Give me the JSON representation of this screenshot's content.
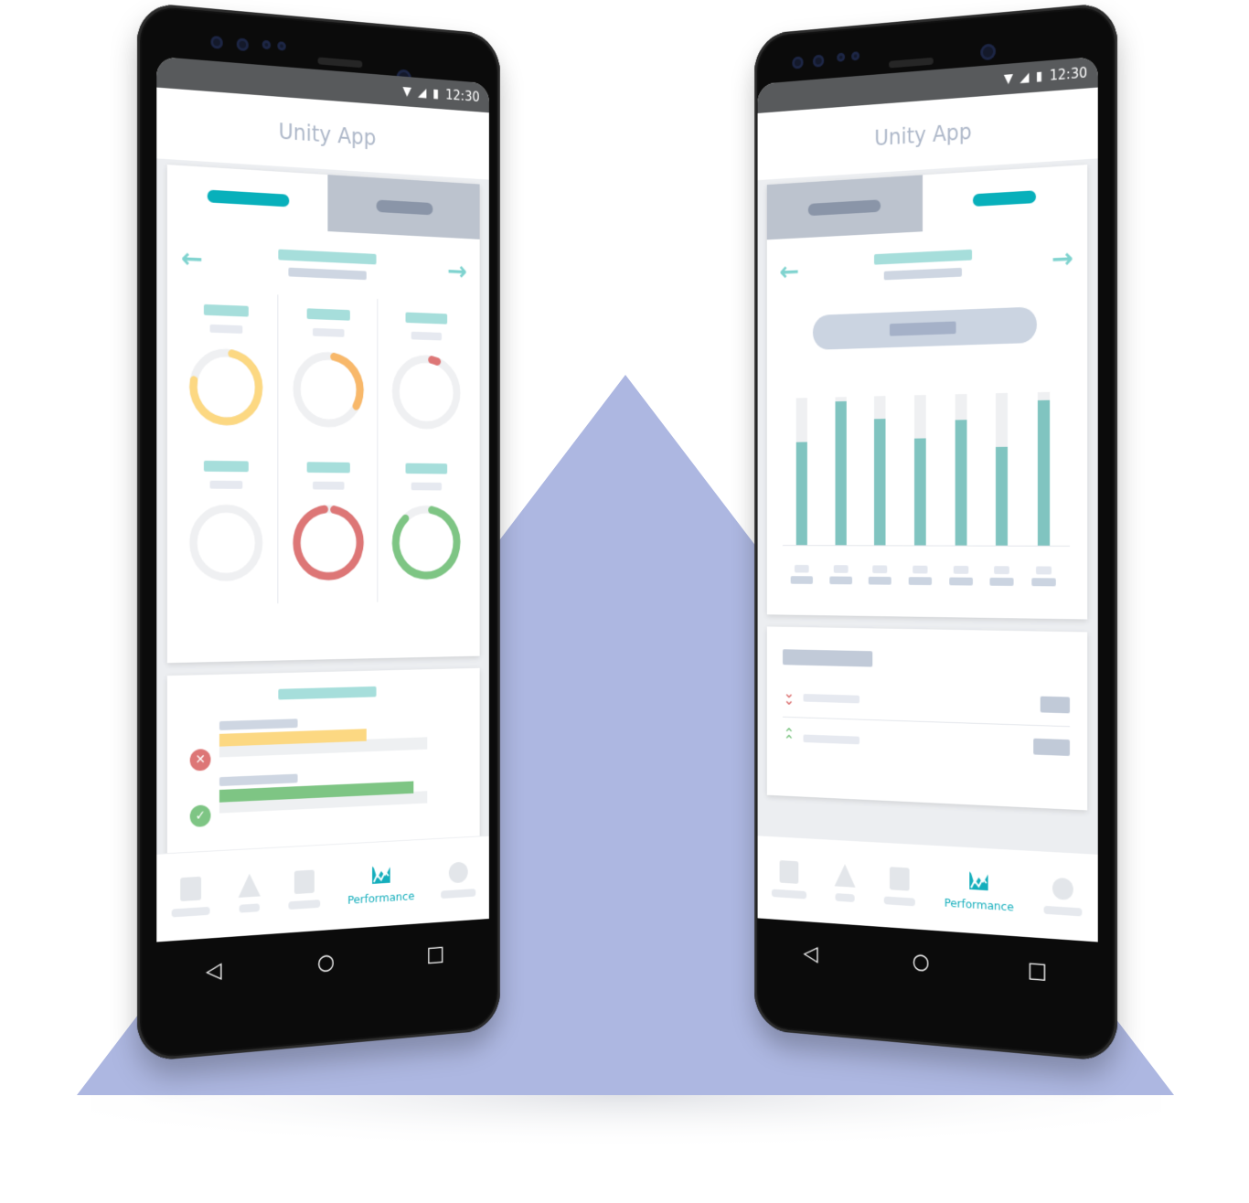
{
  "colors": {
    "backdrop_triangle": "#adb7e1",
    "accent_teal": "#08b0bb",
    "placeholder_teal": "#a6dedb",
    "bar_teal": "#80c4c0",
    "gauge_yellow": "#fcd882",
    "gauge_orange": "#f8b86a",
    "gauge_red": "#dd7676",
    "gauge_green": "#7ec584",
    "gauge_track": "#eff0f2",
    "status_bar": "#585a5c"
  },
  "status_bar": {
    "time": "12:30",
    "icons": [
      "wifi-icon",
      "signal-icon",
      "battery-icon"
    ]
  },
  "phones": [
    {
      "id": "left",
      "app_title": "Unity App",
      "active_tab_index": 0,
      "nav_prev_icon": "arrow-left-icon",
      "nav_next_icon": "arrow-right-icon",
      "gauges": [
        {
          "color": "gauge_yellow",
          "fraction": 0.75
        },
        {
          "color": "gauge_orange",
          "fraction": 0.3
        },
        {
          "color": "gauge_red",
          "fraction": 0.03
        },
        {
          "color": "gauge_track",
          "fraction": 0.0
        },
        {
          "color": "gauge_red",
          "fraction": 0.95
        },
        {
          "color": "gauge_green",
          "fraction": 0.85
        }
      ],
      "metrics": [
        {
          "status": "fail",
          "status_icon": "x-circle-icon",
          "color": "#fcd882",
          "fraction": 0.7
        },
        {
          "status": "pass",
          "status_icon": "check-circle-icon",
          "color": "#7ec584",
          "fraction": 0.93
        }
      ]
    },
    {
      "id": "right",
      "app_title": "Unity App",
      "active_tab_index": 1,
      "nav_prev_icon": "arrow-left-icon",
      "nav_next_icon": "arrow-right-icon",
      "trends": [
        {
          "direction": "down",
          "icon": "double-chevron-down-icon",
          "color": "#dd7676"
        },
        {
          "direction": "up",
          "icon": "double-chevron-up-icon",
          "color": "#7ec584"
        }
      ]
    }
  ],
  "bottom_nav": {
    "items": [
      {
        "name": "nav-item-1",
        "shape": "square",
        "label": ""
      },
      {
        "name": "nav-item-2",
        "shape": "triangle",
        "label": ""
      },
      {
        "name": "nav-item-3",
        "shape": "square",
        "label": ""
      },
      {
        "name": "nav-item-performance",
        "shape": "chart",
        "label": "Performance",
        "active": true
      },
      {
        "name": "nav-item-5",
        "shape": "circle",
        "label": ""
      }
    ]
  },
  "system_nav": {
    "back": "◁",
    "home": "○",
    "recents": "□"
  },
  "chart_data": {
    "type": "bar",
    "title": "",
    "xlabel": "",
    "ylabel": "",
    "categories": [
      "",
      "",
      "",
      "",
      "",
      "",
      ""
    ],
    "values": [
      0.7,
      0.97,
      0.85,
      0.71,
      0.83,
      0.65,
      0.95
    ],
    "ylim": [
      0,
      1
    ],
    "grid": false,
    "legend": "none"
  }
}
